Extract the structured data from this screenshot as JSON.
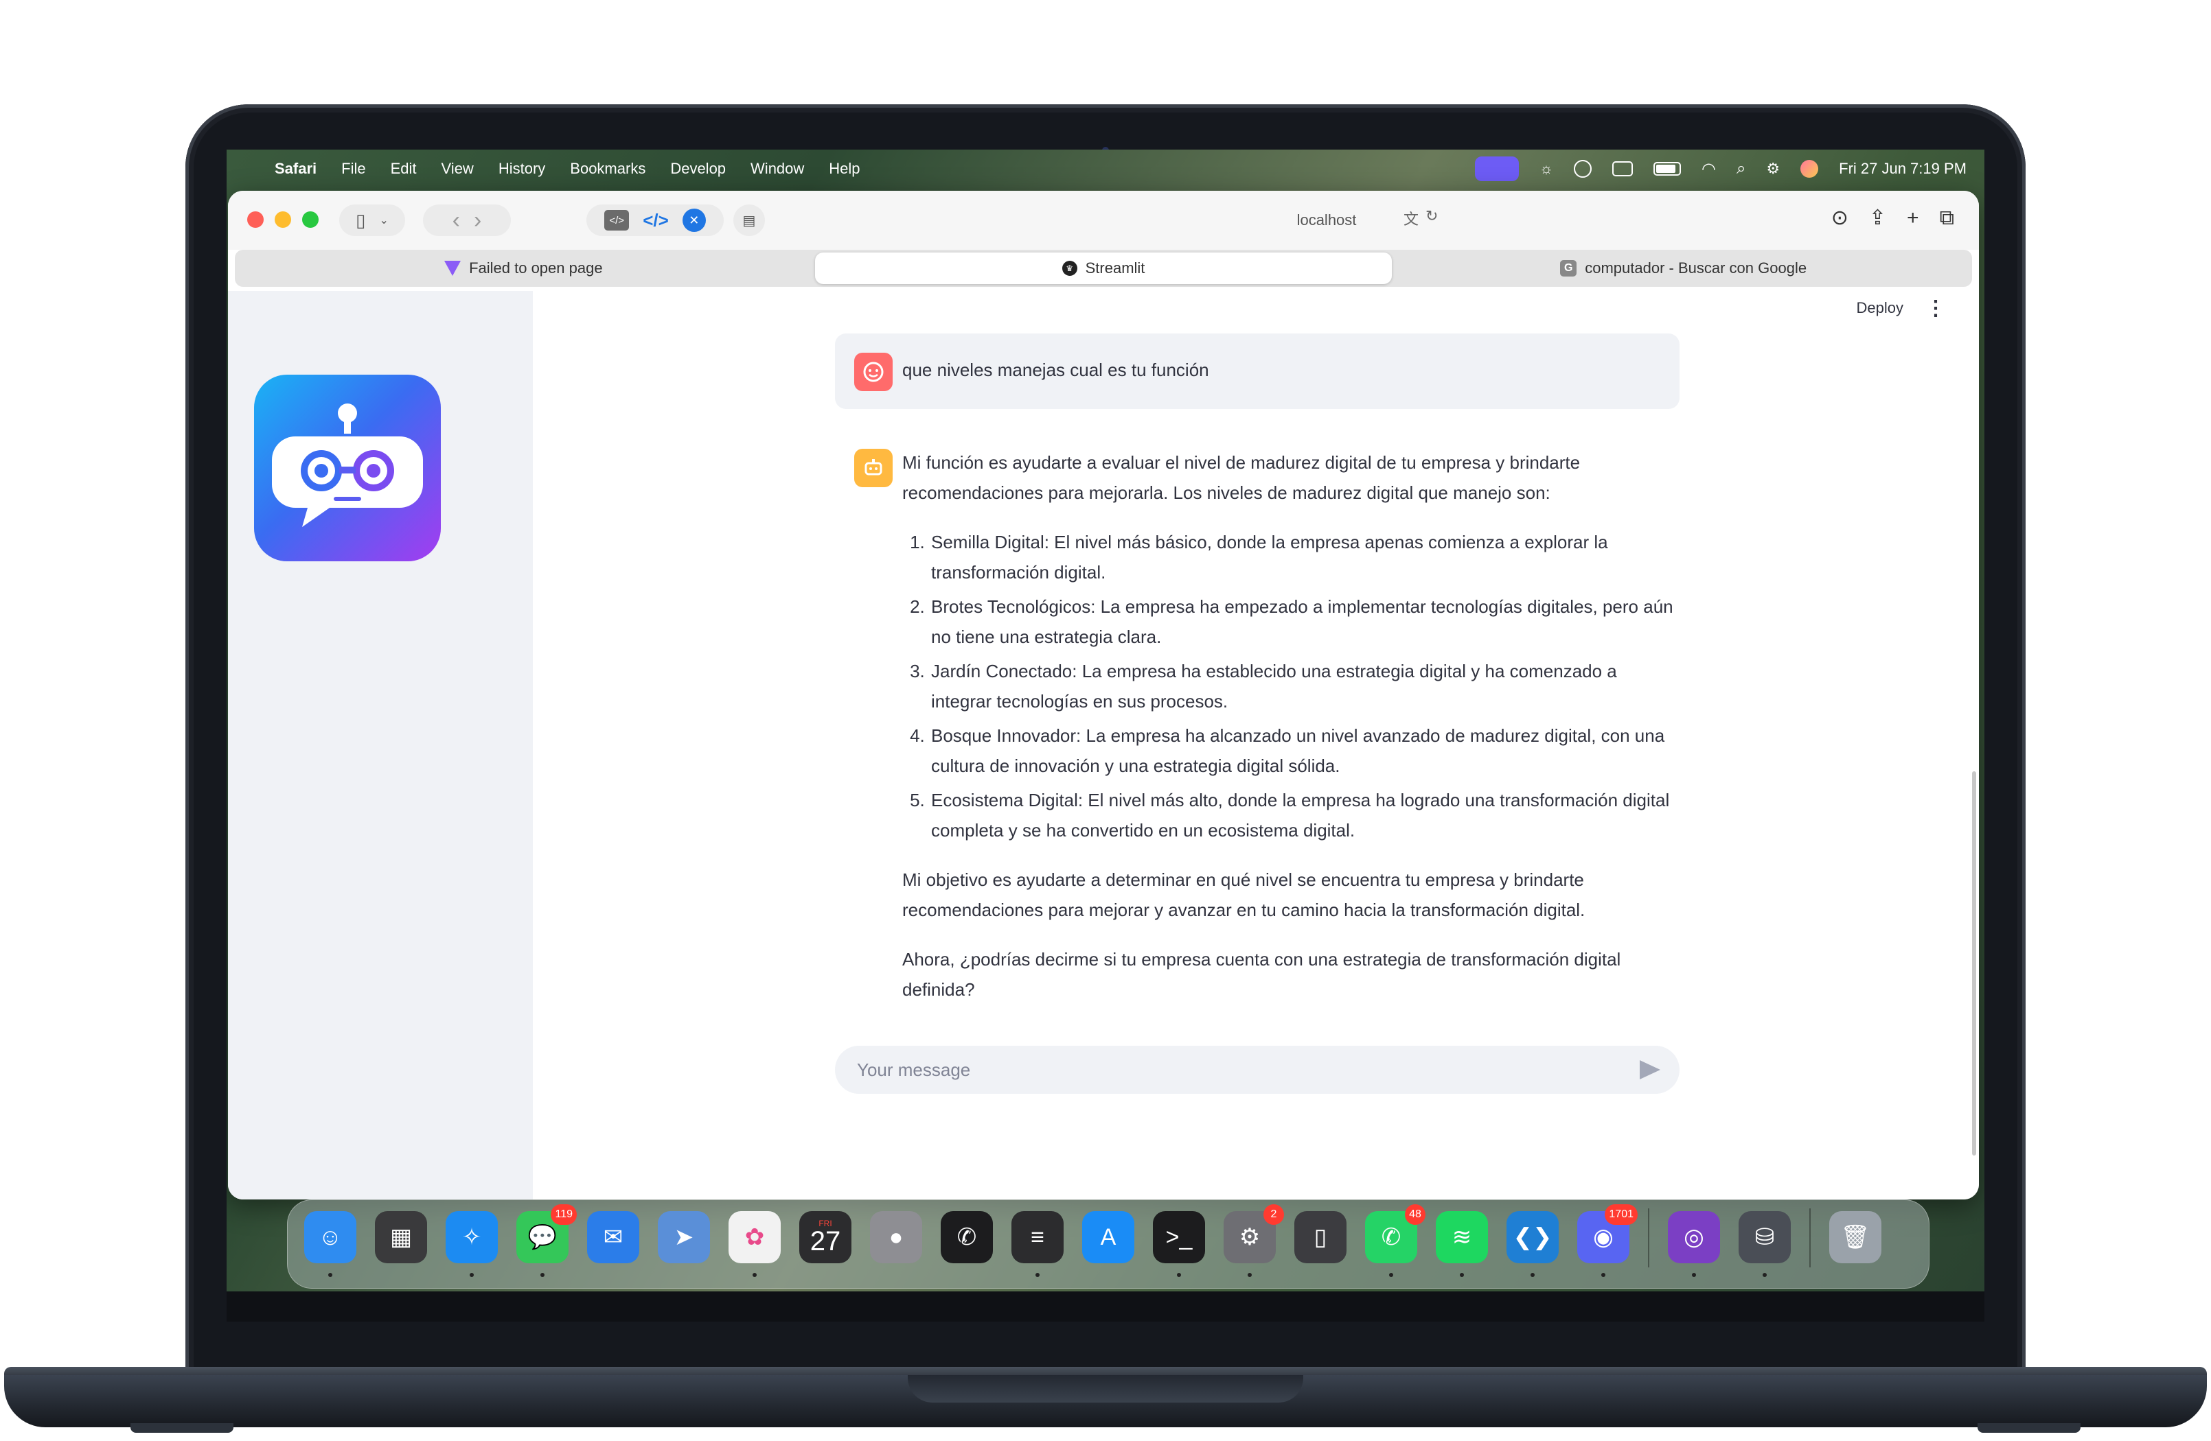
{
  "menubar": {
    "app_name": "Safari",
    "menus": [
      "File",
      "Edit",
      "View",
      "History",
      "Bookmarks",
      "Develop",
      "Window",
      "Help"
    ],
    "clock": "Fri 27 Jun  7:19 PM"
  },
  "browser": {
    "address": "localhost",
    "tabs": [
      {
        "title": "Failed to open page",
        "icon": "vite-icon"
      },
      {
        "title": "Streamlit",
        "icon": "streamlit-icon"
      },
      {
        "title": "computador - Buscar con Google",
        "icon": "google-icon"
      }
    ],
    "active_tab": "Streamlit"
  },
  "app": {
    "deploy_label": "Deploy",
    "user_message": "que niveles manejas cual es tu función",
    "bot_intro": "Mi función es ayudarte a evaluar el nivel de madurez digital de tu empresa y brindarte recomendaciones para mejorarla. Los niveles de madurez digital que manejo son:",
    "levels": [
      "Semilla Digital: El nivel más básico, donde la empresa apenas comienza a explorar la transformación digital.",
      "Brotes Tecnológicos: La empresa ha empezado a implementar tecnologías digitales, pero aún no tiene una estrategia clara.",
      "Jardín Conectado: La empresa ha establecido una estrategia digital y ha comenzado a integrar tecnologías en sus procesos.",
      "Bosque Innovador: La empresa ha alcanzado un nivel avanzado de madurez digital, con una cultura de innovación y una estrategia digital sólida.",
      "Ecosistema Digital: El nivel más alto, donde la empresa ha logrado una transformación digital completa y se ha convertido en un ecosistema digital."
    ],
    "bot_goal": "Mi objetivo es ayudarte a determinar en qué nivel se encuentra tu empresa y brindarte recomendaciones para mejorar y avanzar en tu camino hacia la transformación digital.",
    "bot_question": "Ahora, ¿podrías decirme si tu empresa cuenta con una estrategia de transformación digital definida?",
    "input_placeholder": "Your message"
  },
  "dock": {
    "apps": [
      {
        "name": "finder-icon",
        "color": "#2f8cf0"
      },
      {
        "name": "launchpad-icon",
        "color": "#3a3a3c"
      },
      {
        "name": "safari-icon",
        "color": "#1c8bf2"
      },
      {
        "name": "messages-icon",
        "color": "#34c759",
        "badge": "119"
      },
      {
        "name": "mail-icon",
        "color": "#2b7de9"
      },
      {
        "name": "maps-icon",
        "color": "#5a8fd8"
      },
      {
        "name": "photos-icon",
        "color": "#f2f2f2"
      },
      {
        "name": "calendar-icon",
        "color": "#2c2c2e",
        "label": "27",
        "sublabel": "FRI"
      },
      {
        "name": "contacts-icon",
        "color": "#8e8e93"
      },
      {
        "name": "phone-icon",
        "color": "#1c1c1e"
      },
      {
        "name": "notes-icon",
        "color": "#2c2c2e"
      },
      {
        "name": "app-store-icon",
        "color": "#1a8cf6"
      },
      {
        "name": "terminal-icon",
        "color": "#1c1c1e"
      },
      {
        "name": "system-settings-icon",
        "color": "#6e6e73",
        "badge": "2"
      },
      {
        "name": "iphone-mirroring-icon",
        "color": "#3c3c40"
      },
      {
        "name": "whatsapp-icon",
        "color": "#25d366",
        "badge": "48"
      },
      {
        "name": "spotify-icon",
        "color": "#1ed760"
      },
      {
        "name": "vscode-icon",
        "color": "#1f7fd4"
      },
      {
        "name": "discord-icon",
        "color": "#5865f2",
        "badge": "1701"
      },
      {
        "name": "github-desktop-icon",
        "color": "#7b3fc4"
      },
      {
        "name": "db-app-icon",
        "color": "#4a4e56"
      },
      {
        "name": "trash-icon",
        "color": "#9aa2aa"
      }
    ]
  }
}
